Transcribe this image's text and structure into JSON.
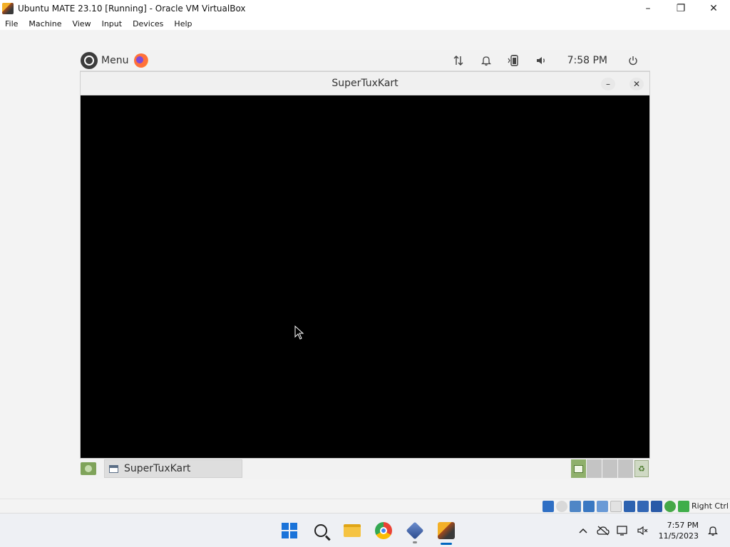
{
  "host_window": {
    "title": "Ubuntu MATE 23.10 [Running] - Oracle VM VirtualBox",
    "controls": {
      "minimize": "–",
      "maximize": "❐",
      "close": "✕"
    }
  },
  "host_menu": [
    "File",
    "Machine",
    "View",
    "Input",
    "Devices",
    "Help"
  ],
  "guest_top_panel": {
    "menu_label": "Menu",
    "tray_icons": [
      "network-icon",
      "notification-bell-icon",
      "battery-icon",
      "volume-icon"
    ],
    "time": "7:58 PM",
    "power_icon": "power-icon"
  },
  "app_window": {
    "title": "SuperTuxKart",
    "minimize_label": "–",
    "close_label": "✕",
    "content_color": "#000000"
  },
  "guest_bottom_panel": {
    "task_label": "SuperTuxKart",
    "workspace_count": 4,
    "active_workspace": 1
  },
  "vbox_status": {
    "host_key": "Right Ctrl"
  },
  "windows_taskbar": {
    "apps": [
      "start-icon",
      "search-icon",
      "file-explorer-icon",
      "chrome-icon",
      "virtualbox-icon",
      "supertuxkart-icon"
    ],
    "clock_time": "7:57 PM",
    "clock_date": "11/5/2023"
  },
  "colors": {
    "accent_green": "#8fb06b",
    "windows_blue": "#1a73d9",
    "taskbar_active": "#0067c0"
  }
}
